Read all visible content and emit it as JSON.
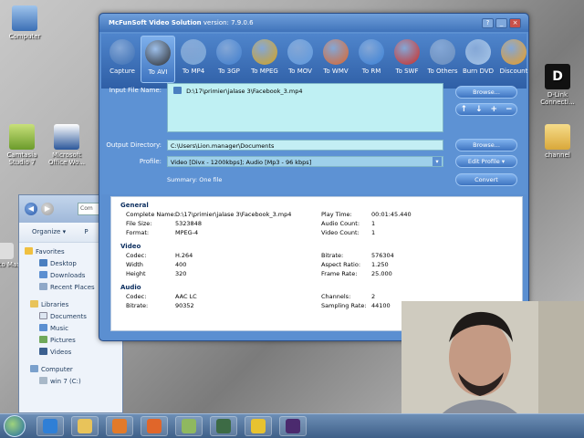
{
  "desktop": {
    "icons": [
      {
        "label": "Computer",
        "icon": "computer-icon"
      },
      {
        "label": "Camtasia Studio 7",
        "icon": "camtasia-icon"
      },
      {
        "label": "Microsoft Office Wo...",
        "icon": "word-icon"
      },
      {
        "label": "D-Link Connecti...",
        "icon": "dlink-icon"
      },
      {
        "label": "channel",
        "icon": "folder-icon"
      },
      {
        "label": "Auto Max",
        "icon": "app-icon"
      }
    ]
  },
  "explorer": {
    "address": "Com",
    "toolbar": {
      "organize": "Organize ▾",
      "p": "P"
    },
    "nav": {
      "favorites_header": "Favorites",
      "favorites": [
        "Desktop",
        "Downloads",
        "Recent Places"
      ],
      "libraries_header": "Libraries",
      "libraries": [
        "Documents",
        "Music",
        "Pictures",
        "Videos"
      ],
      "computer_header": "Computer",
      "computer_items": [
        "win 7 (C:)"
      ]
    }
  },
  "app": {
    "title_brand": "McFunSoft Video Solution",
    "title_version": "version: 7.9.0.6",
    "toolbar": [
      {
        "label": "Capture",
        "icon": "capture-icon",
        "color": "#3b6fb5"
      },
      {
        "label": "To AVI",
        "icon": "film-reel-icon",
        "color": "#2d2d2d",
        "selected": true
      },
      {
        "label": "To MP4",
        "icon": "mp4-player-icon",
        "color": "#7aa7d8"
      },
      {
        "label": "To 3GP",
        "icon": "phone-icon",
        "color": "#3f7fd0"
      },
      {
        "label": "To MPEG",
        "icon": "clapper-icon",
        "color": "#d9a51c"
      },
      {
        "label": "To MOV",
        "icon": "mov-icon",
        "color": "#5f9be0"
      },
      {
        "label": "To WMV",
        "icon": "wmv-icon",
        "color": "#e0662a"
      },
      {
        "label": "To RM",
        "icon": "rm-icon",
        "color": "#3b82d8"
      },
      {
        "label": "To SWF",
        "icon": "flash-icon",
        "color": "#d22b22"
      },
      {
        "label": "To Others",
        "icon": "others-reel-icon",
        "color": "#6a8fbf"
      },
      {
        "label": "Burn DVD",
        "icon": "dvd-icon",
        "color": "#a8c8ea"
      },
      {
        "label": "Discount",
        "icon": "discount-icon",
        "color": "#f0a020"
      }
    ],
    "input_label": "Input File Name:",
    "input_file": "D:\\17\\primier\\jalase 3\\Facebook_3.mp4",
    "browse_label": "Browse...",
    "output_label": "Output Directory:",
    "output_dir": "C:\\Users\\Lion.manager\\Documents",
    "profile_label": "Profile:",
    "profile_value": "Video [Divx - 1200kbps]; Audio [Mp3 - 96 kbps]",
    "edit_profile_label": "Edit Profile",
    "summary_label": "Summary:",
    "summary_value": "One file",
    "convert_label": "Convert",
    "info": {
      "general_header": "General",
      "general": [
        {
          "k": "Complete Name:",
          "v": "D:\\17\\primier\\jalase 3\\Facebook_3.mp4"
        },
        {
          "k": "File Size:",
          "v": "5323848"
        },
        {
          "k": "Format:",
          "v": "MPEG-4"
        }
      ],
      "general_right": [
        {
          "k": "Play Time:",
          "v": "00:01:45.440"
        },
        {
          "k": "Audio Count:",
          "v": "1"
        },
        {
          "k": "Video Count:",
          "v": "1"
        }
      ],
      "video_header": "Video",
      "video": [
        {
          "k": "Codec:",
          "v": "H.264"
        },
        {
          "k": "Width",
          "v": "400"
        },
        {
          "k": "Height",
          "v": "320"
        }
      ],
      "video_right": [
        {
          "k": "Bitrate:",
          "v": "576304"
        },
        {
          "k": "Aspect Ratio:",
          "v": "1.250"
        },
        {
          "k": "Frame Rate:",
          "v": "25.000"
        }
      ],
      "audio_header": "Audio",
      "audio": [
        {
          "k": "Codec:",
          "v": "AAC LC"
        },
        {
          "k": "Bitrate:",
          "v": "90352"
        }
      ],
      "audio_right": [
        {
          "k": "Channels:",
          "v": "2"
        },
        {
          "k": "Sampling Rate:",
          "v": "44100"
        }
      ]
    }
  },
  "taskbar": {
    "items": [
      {
        "icon": "ie-icon",
        "color": "#2f7fd6"
      },
      {
        "icon": "folder-icon",
        "color": "#e8c35a"
      },
      {
        "icon": "media-player-icon",
        "color": "#e27a2a"
      },
      {
        "icon": "firefox-icon",
        "color": "#e0662a"
      },
      {
        "icon": "app-green-icon",
        "color": "#8fb860"
      },
      {
        "icon": "camera-icon",
        "color": "#3d6b45"
      },
      {
        "icon": "mcfunsoft-icon",
        "color": "#e7c230"
      },
      {
        "icon": "premiere-icon",
        "color": "#4b2a6e"
      }
    ]
  }
}
